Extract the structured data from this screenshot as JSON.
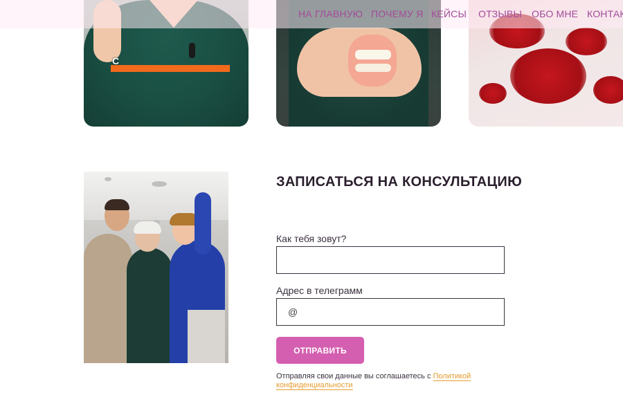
{
  "nav": {
    "items": [
      "НА ГЛАВНУЮ",
      "ПОЧЕМУ Я",
      "КЕЙСЫ",
      "ОТЗЫВЫ",
      "ОБО МНЕ",
      "КОНТАКТ"
    ]
  },
  "gallery": {
    "caption_char": "C"
  },
  "form": {
    "title": "ЗАПИСАТЬСЯ НА КОНСУЛЬТАЦИЮ",
    "name_label": "Как тебя зовут?",
    "name_value": "",
    "telegram_label": "Адрес в телеграмм",
    "telegram_value": "@",
    "submit_label": "ОТПРАВИТЬ",
    "consent_text": "Отправляя свои данные вы соглашаетесь с ",
    "consent_link": "Политикой конфиденциальности"
  },
  "colors": {
    "accent": "#d45fb0",
    "nav_text": "#a24a9a",
    "link": "#e59b2c",
    "caption_bar": "#f26a1b"
  }
}
